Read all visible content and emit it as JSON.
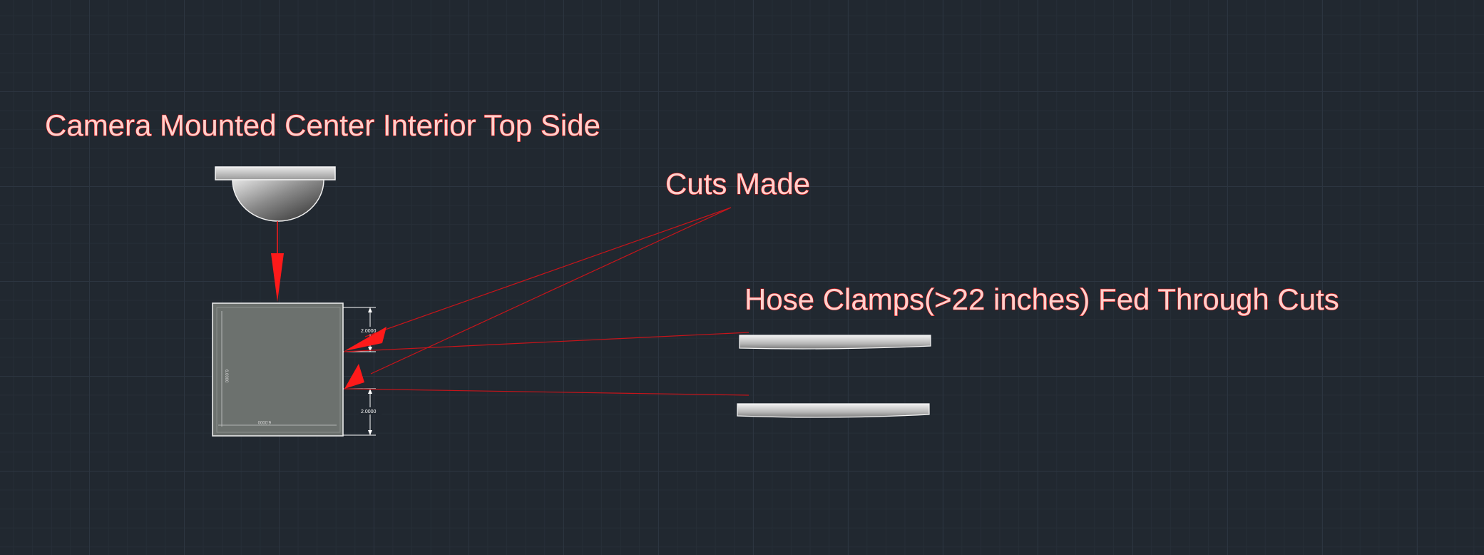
{
  "labels": {
    "camera": "Camera Mounted Center Interior Top Side",
    "cuts": "Cuts Made",
    "hose_clamps": "Hose Clamps(>22 inches) Fed Through Cuts"
  },
  "dimensions": {
    "upper_gap": "2.0000",
    "lower_gap": "2.0000",
    "box_height": "6.0000",
    "box_width": "6.0000"
  },
  "colors": {
    "background": "#212830",
    "annotation_text": "#ffd0cc",
    "leader_red": "#ff1a1a",
    "box_fill": "#6c716e"
  }
}
